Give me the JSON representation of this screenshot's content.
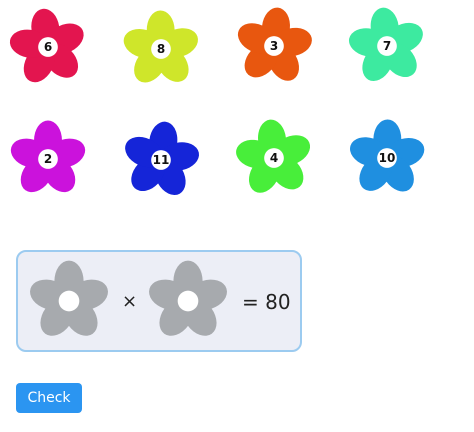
{
  "flowers": [
    {
      "number": "6",
      "color": "#e3154f"
    },
    {
      "number": "8",
      "color": "#cfe62a"
    },
    {
      "number": "3",
      "color": "#e8570f"
    },
    {
      "number": "7",
      "color": "#3deaa0"
    },
    {
      "number": "2",
      "color": "#cb12dc"
    },
    {
      "number": "11",
      "color": "#1525d8"
    },
    {
      "number": "4",
      "color": "#48ee3a"
    },
    {
      "number": "10",
      "color": "#1f8fe0"
    }
  ],
  "equation": {
    "operator": "×",
    "result": "= 80",
    "slot_color": "#a7aaae"
  },
  "check_button": {
    "label": "Check"
  }
}
